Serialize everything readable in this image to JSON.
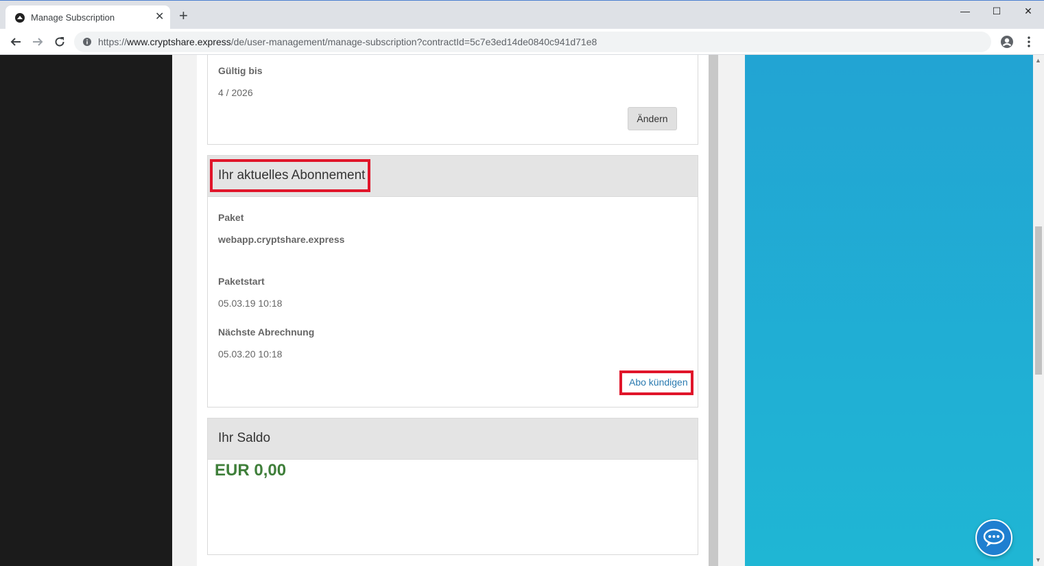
{
  "browser": {
    "tab_title": "Manage Subscription",
    "url_scheme": "https://",
    "url_host": "www.cryptshare.express",
    "url_path": "/de/user-management/manage-subscription?contractId=5c7e3ed14de0840c941d71e8",
    "new_tab_symbol": "+",
    "close_symbol": "✕",
    "minimize_symbol": "—",
    "maximize_symbol": "☐",
    "window_close_symbol": "✕"
  },
  "payment_card": {
    "valid_until_label": "Gültig bis",
    "valid_until_value": "4 / 2026",
    "change_button": "Ändern"
  },
  "subscription_card": {
    "title": "Ihr aktuelles Abonnement",
    "package_label": "Paket",
    "package_value": "webapp.cryptshare.express",
    "start_label": "Paketstart",
    "start_value": "05.03.19 10:18",
    "next_billing_label": "Nächste Abrechnung",
    "next_billing_value": "05.03.20 10:18",
    "cancel_link": "Abo kündigen"
  },
  "balance_card": {
    "title": "Ihr Saldo",
    "amount": "EUR 0,00"
  },
  "colors": {
    "highlight": "#e0152a",
    "amount_green": "#3f7f3a",
    "link_blue": "#2a7ab0",
    "chat_blue": "#1f7fd0"
  },
  "icons": [
    "app-favicon-icon",
    "back-arrow-icon",
    "forward-arrow-icon",
    "reload-icon",
    "site-info-icon",
    "profile-icon",
    "menu-dots-icon",
    "chat-bubble-icon"
  ]
}
